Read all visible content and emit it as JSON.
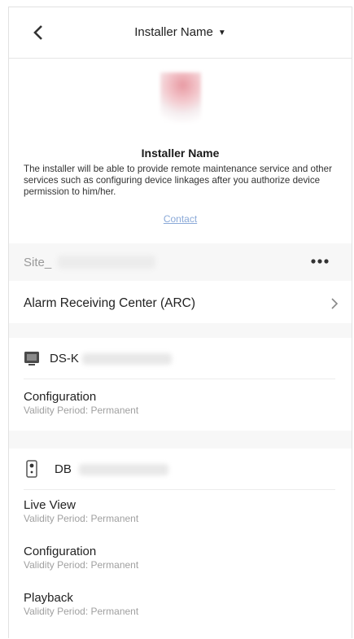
{
  "header": {
    "title": "Installer Name"
  },
  "installer": {
    "name": "Installer Name",
    "description": "The installer will be able to provide remote maintenance service and other services such as configuring device linkages after you authorize device permission to him/her.",
    "contact_label": "Contact"
  },
  "site": {
    "label": "Site_"
  },
  "arc": {
    "label": "Alarm Receiving Center (ARC)"
  },
  "devices": [
    {
      "name": "DS-K",
      "icon": "monitor-icon",
      "permissions": [
        {
          "title": "Configuration",
          "validity": "Validity Period:  Permanent"
        }
      ]
    },
    {
      "name": "DB",
      "icon": "doorbell-icon",
      "permissions": [
        {
          "title": "Live View",
          "validity": "Validity Period:  Permanent"
        },
        {
          "title": "Configuration",
          "validity": "Validity Period:  Permanent"
        },
        {
          "title": "Playback",
          "validity": "Validity Period:  Permanent"
        }
      ]
    }
  ],
  "colors": {
    "link": "#8aa9d8",
    "muted": "#a0a0a0",
    "section_bg": "#f7f7f7"
  }
}
